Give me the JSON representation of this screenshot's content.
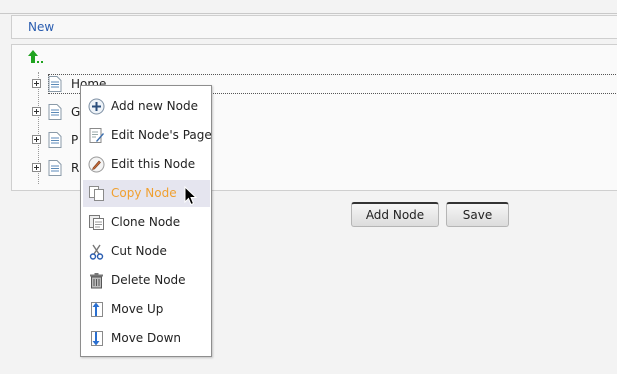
{
  "header": {
    "new_link": "New"
  },
  "tree": {
    "nodes": [
      {
        "label": "Home"
      },
      {
        "label": "G"
      },
      {
        "label": "P"
      },
      {
        "label": "R"
      }
    ]
  },
  "buttons": {
    "add_node": "Add Node",
    "save": "Save"
  },
  "context_menu": {
    "items": [
      {
        "label": "Add new Node",
        "icon": "add-icon"
      },
      {
        "label": "Edit Node's Page",
        "icon": "edit-page-icon"
      },
      {
        "label": "Edit this Node",
        "icon": "pencil-icon"
      },
      {
        "label": "Copy Node",
        "icon": "copy-icon",
        "highlighted": true
      },
      {
        "label": "Clone Node",
        "icon": "clone-icon"
      },
      {
        "label": "Cut Node",
        "icon": "scissors-icon"
      },
      {
        "label": "Delete Node",
        "icon": "trash-icon"
      },
      {
        "label": "Move Up",
        "icon": "move-up-icon"
      },
      {
        "label": "Move Down",
        "icon": "move-down-icon"
      }
    ]
  },
  "colors": {
    "link": "#2a5db0",
    "highlight_text": "#f0a030",
    "highlight_bg": "#e5e5ef"
  }
}
